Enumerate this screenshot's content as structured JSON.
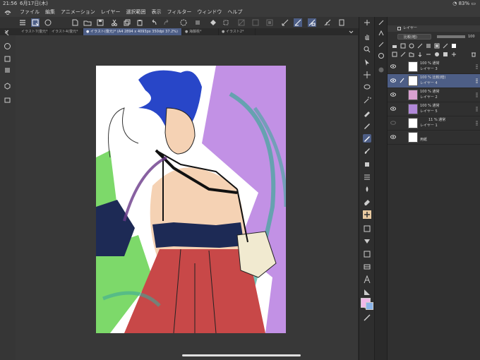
{
  "status": {
    "time": "21:56",
    "date": "6月17日(木)",
    "battery": "83%"
  },
  "menu": [
    "ファイル",
    "編集",
    "アニメーション",
    "レイヤー",
    "選択範囲",
    "表示",
    "フィルター",
    "ウィンドウ",
    "ヘルプ"
  ],
  "tabs": [
    {
      "label": "イラスト7(復元*"
    },
    {
      "label": "イラスト4(復元*"
    },
    {
      "label": "● イラスト(復元)* (A4 2894 x 4093px 350dpi 37.2%)",
      "active": true
    },
    {
      "label": "● 海藤桃*"
    },
    {
      "label": "● イラスト2*"
    }
  ],
  "layer_panel": {
    "title": "レイヤー",
    "blend_mode": "比較(暗)",
    "opacity": "100",
    "layers": [
      {
        "meta": "100 % 通常",
        "name": "レイヤー 3"
      },
      {
        "meta": "100 % 比較(暗)",
        "name": "レイヤー 4",
        "selected": true
      },
      {
        "meta": "100 % 通常",
        "name": "レイヤー 2"
      },
      {
        "meta": "100 % 通常",
        "name": "レイヤー 5"
      },
      {
        "meta": "11 % 通常",
        "name": "レイヤー 1"
      },
      {
        "meta": "",
        "name": "用紙"
      }
    ]
  },
  "colors": {
    "accent": "#4d5e86",
    "main_color": "#f0b8e8",
    "sub_color": "#8ab4e8"
  }
}
